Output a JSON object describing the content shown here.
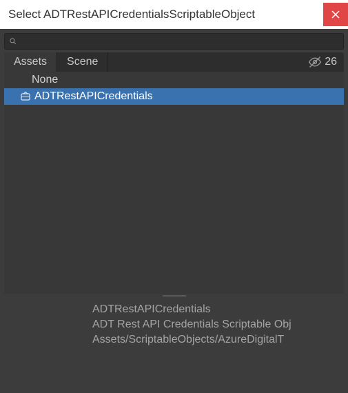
{
  "title": "Select ADTRestAPICredentialsScriptableObject",
  "search": {
    "value": "",
    "placeholder": ""
  },
  "tabs": [
    {
      "label": "Assets",
      "active": true
    },
    {
      "label": "Scene",
      "active": false
    }
  ],
  "hidden_count": "26",
  "items": [
    {
      "label": "None",
      "selected": false,
      "icon": null
    },
    {
      "label": "ADTRestAPICredentials",
      "selected": true,
      "icon": "scriptable-object-icon"
    }
  ],
  "detail": {
    "name": "ADTRestAPICredentials",
    "type": "ADT Rest API Credentials Scriptable Obj",
    "path": "Assets/ScriptableObjects/AzureDigitalT"
  },
  "colors": {
    "selected": "#3a72b0",
    "panel": "#383838",
    "chrome": "#3c3c3c",
    "close": "#e04646"
  }
}
